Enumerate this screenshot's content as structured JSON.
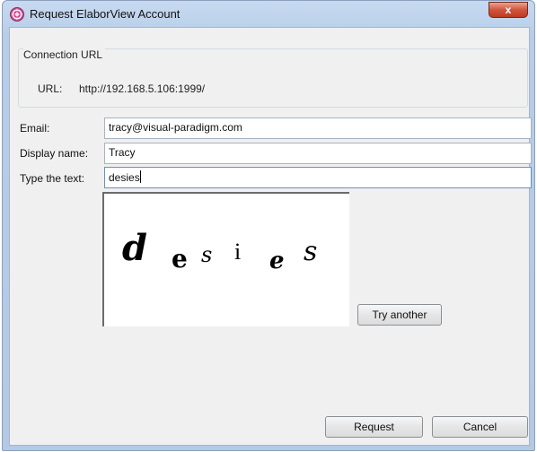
{
  "window": {
    "title": "Request ElaborView Account",
    "close_symbol": "x"
  },
  "connection": {
    "group_title": "Connection URL",
    "url_label": "URL:",
    "url_value": "http://192.168.5.106:1999/"
  },
  "form": {
    "email_label": "Email:",
    "email_value": "tracy@visual-paradigm.com",
    "display_name_label": "Display name:",
    "display_name_value": "Tracy",
    "type_text_label": "Type the text:",
    "type_text_value": "desies"
  },
  "captcha": {
    "letters": [
      "d",
      "e",
      "s",
      "i",
      "e",
      "s"
    ],
    "try_another_label": "Try another"
  },
  "buttons": {
    "request_label": "Request",
    "cancel_label": "Cancel"
  },
  "icons": {
    "app": "elaborview-app-icon",
    "close": "close-icon"
  },
  "colors": {
    "titlebar": "#b7cde8",
    "close_button": "#c7452b",
    "dialog_background": "#f0f0f0"
  }
}
